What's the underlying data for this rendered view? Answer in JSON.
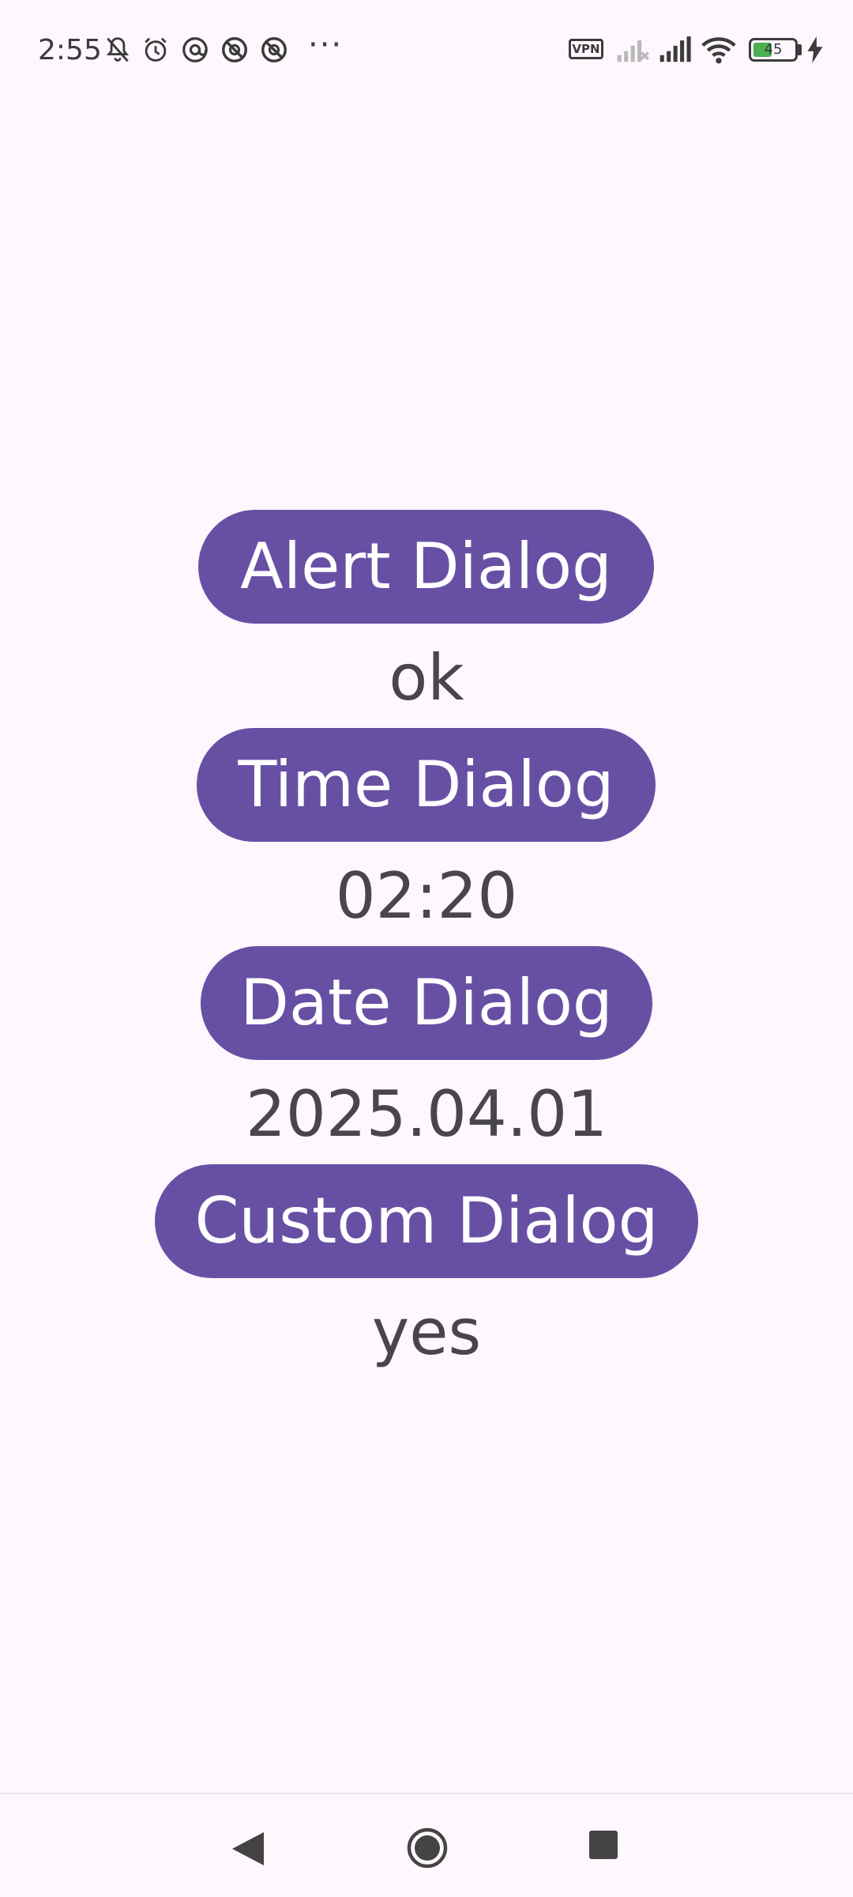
{
  "status_bar": {
    "time": "2:55",
    "vpn_label": "VPN",
    "battery_level": "45",
    "battery_fraction": 0.45,
    "icons": [
      "muted-bell-icon",
      "alarm-icon",
      "at-icon",
      "blocked-at-icon",
      "blocked-at-icon",
      "more-dots-icon",
      "vpn-icon",
      "signal-off-icon",
      "signal-icon",
      "wifi-icon",
      "battery-icon",
      "charging-icon"
    ],
    "more": "···"
  },
  "main": {
    "alert_button_label": "Alert Dialog",
    "alert_result": "ok",
    "time_button_label": "Time Dialog",
    "time_result": "02:20",
    "date_button_label": "Date Dialog",
    "date_result": "2025.04.01",
    "custom_button_label": "Custom Dialog",
    "custom_result": "yes"
  },
  "colors": {
    "background": "#FEF7FE",
    "button": "#6750A4",
    "button_text": "#FFFFFF",
    "result_text": "#49454F"
  },
  "nav_bar": {
    "icons": [
      "back-icon",
      "home-icon",
      "recents-icon"
    ]
  }
}
